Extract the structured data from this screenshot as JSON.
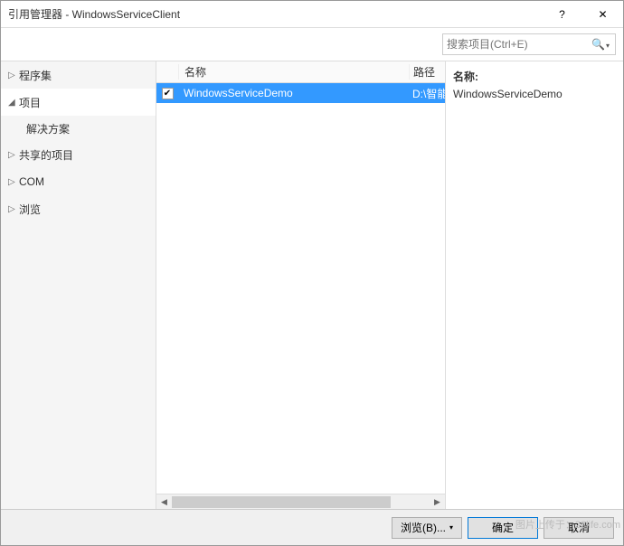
{
  "titlebar": {
    "title": "引用管理器 - WindowsServiceClient"
  },
  "search": {
    "placeholder": "搜索项目(Ctrl+E)"
  },
  "sidebar": {
    "items": [
      {
        "label": "程序集",
        "expanded": false
      },
      {
        "label": "项目",
        "expanded": true,
        "children": [
          {
            "label": "解决方案"
          }
        ]
      },
      {
        "label": "共享的项目",
        "expanded": false
      },
      {
        "label": "COM",
        "expanded": false
      },
      {
        "label": "浏览",
        "expanded": false
      }
    ]
  },
  "list": {
    "headers": {
      "name": "名称",
      "path": "路径"
    },
    "rows": [
      {
        "checked": true,
        "name": "WindowsServiceDemo",
        "path": "D:\\智能"
      }
    ]
  },
  "details": {
    "label": "名称:",
    "value": "WindowsServiceDemo"
  },
  "footer": {
    "browse": "浏览(B)...",
    "ok": "确定",
    "cancel": "取消"
  },
  "watermark": "图片上传于：28life.com"
}
